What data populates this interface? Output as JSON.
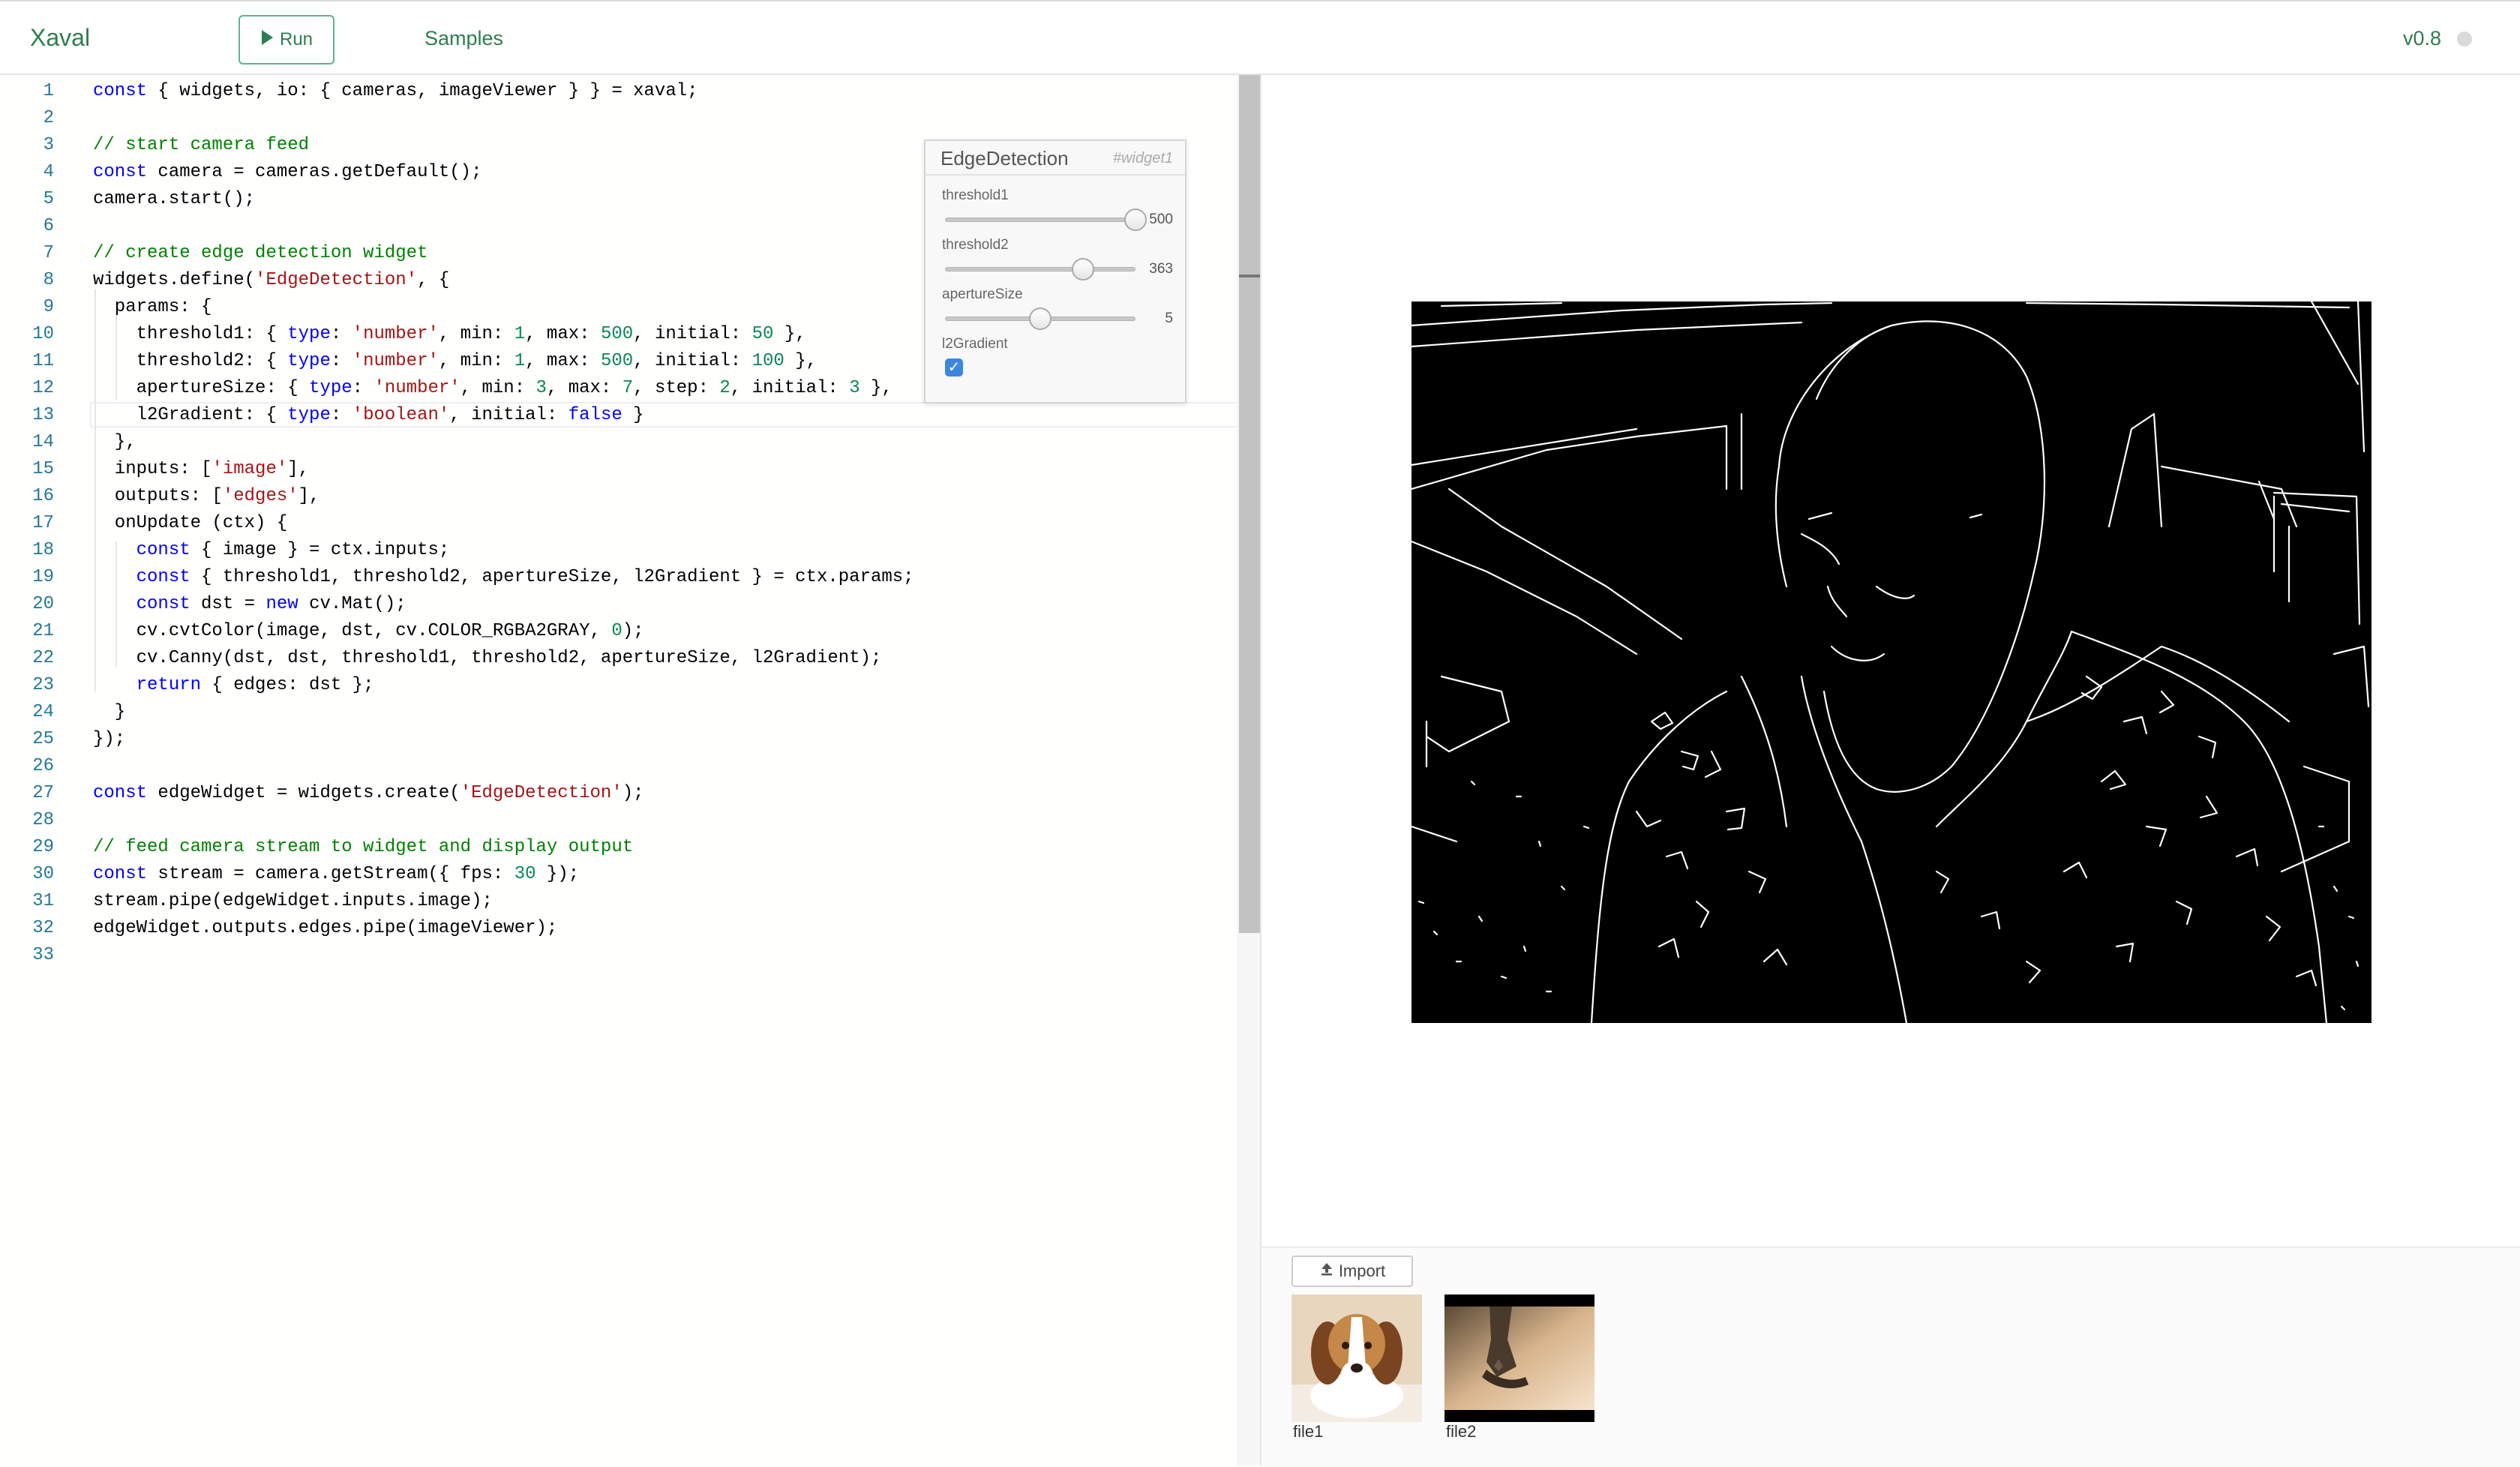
{
  "header": {
    "brand": "Xaval",
    "run_label": "Run",
    "samples_label": "Samples",
    "version": "v0.8"
  },
  "editor": {
    "lines": [
      {
        "n": "1",
        "html": "<span class=\"kw\">const</span> { widgets, io: { cameras, imageViewer } } = xaval;"
      },
      {
        "n": "2",
        "html": ""
      },
      {
        "n": "3",
        "html": "<span class=\"cmt\">// start camera feed</span>"
      },
      {
        "n": "4",
        "html": "<span class=\"kw\">const</span> camera = cameras.getDefault();"
      },
      {
        "n": "5",
        "html": "camera.start();"
      },
      {
        "n": "6",
        "html": ""
      },
      {
        "n": "7",
        "html": "<span class=\"cmt\">// create edge detection widget</span>"
      },
      {
        "n": "8",
        "html": "widgets.define(<span class=\"str\">'EdgeDetection'</span>, {"
      },
      {
        "n": "9",
        "html": "  params: {"
      },
      {
        "n": "10",
        "html": "    threshold1: { <span class=\"kw\">type</span>: <span class=\"str\">'number'</span>, min: <span class=\"num\">1</span>, max: <span class=\"num\">500</span>, initial: <span class=\"num\">50</span> },"
      },
      {
        "n": "11",
        "html": "    threshold2: { <span class=\"kw\">type</span>: <span class=\"str\">'number'</span>, min: <span class=\"num\">1</span>, max: <span class=\"num\">500</span>, initial: <span class=\"num\">100</span> },"
      },
      {
        "n": "12",
        "html": "    apertureSize: { <span class=\"kw\">type</span>: <span class=\"str\">'number'</span>, min: <span class=\"num\">3</span>, max: <span class=\"num\">7</span>, step: <span class=\"num\">2</span>, initial: <span class=\"num\">3</span> },"
      },
      {
        "n": "13",
        "html": "    l2Gradient: { <span class=\"kw\">type</span>: <span class=\"str\">'boolean'</span>, initial: <span class=\"kw\">false</span> }"
      },
      {
        "n": "14",
        "html": "  },"
      },
      {
        "n": "15",
        "html": "  inputs: [<span class=\"str\">'image'</span>],"
      },
      {
        "n": "16",
        "html": "  outputs: [<span class=\"str\">'edges'</span>],"
      },
      {
        "n": "17",
        "html": "  onUpdate (ctx) {"
      },
      {
        "n": "18",
        "html": "    <span class=\"kw\">const</span> { image } = ctx.inputs;"
      },
      {
        "n": "19",
        "html": "    <span class=\"kw\">const</span> { threshold1, threshold2, apertureSize, l2Gradient } = ctx.params;"
      },
      {
        "n": "20",
        "html": "    <span class=\"kw\">const</span> dst = <span class=\"kw\">new</span> cv.Mat();"
      },
      {
        "n": "21",
        "html": "    cv.cvtColor(image, dst, cv.COLOR_RGBA2GRAY, <span class=\"num\">0</span>);"
      },
      {
        "n": "22",
        "html": "    cv.Canny(dst, dst, threshold1, threshold2, apertureSize, l2Gradient);"
      },
      {
        "n": "23",
        "html": "    <span class=\"kw\">return</span> { edges: dst };"
      },
      {
        "n": "24",
        "html": "  }"
      },
      {
        "n": "25",
        "html": "});"
      },
      {
        "n": "26",
        "html": ""
      },
      {
        "n": "27",
        "html": "<span class=\"kw\">const</span> edgeWidget = widgets.create(<span class=\"str\">'EdgeDetection'</span>);"
      },
      {
        "n": "28",
        "html": ""
      },
      {
        "n": "29",
        "html": "<span class=\"cmt\">// feed camera stream to widget and display output</span>"
      },
      {
        "n": "30",
        "html": "<span class=\"kw\">const</span> stream = camera.getStream({ fps: <span class=\"num\">30</span> });"
      },
      {
        "n": "31",
        "html": "stream.pipe(edgeWidget.inputs.image);"
      },
      {
        "n": "32",
        "html": "edgeWidget.outputs.edges.pipe(imageViewer);"
      },
      {
        "n": "33",
        "html": ""
      }
    ]
  },
  "widget": {
    "title": "EdgeDetection",
    "id": "#widget1",
    "params": [
      {
        "label": "threshold1",
        "value": "500",
        "fraction": 1.0
      },
      {
        "label": "threshold2",
        "value": "363",
        "fraction": 0.725
      },
      {
        "label": "apertureSize",
        "value": "5",
        "fraction": 0.5
      }
    ],
    "bool_param": {
      "label": "l2Gradient",
      "checked": true
    }
  },
  "files": {
    "import_label": "Import",
    "items": [
      {
        "name": "file1",
        "icon": "beagle-puppy-thumbnail"
      },
      {
        "name": "file2",
        "icon": "hand-sunset-thumbnail"
      }
    ]
  },
  "colors": {
    "brand": "#2e7d4f",
    "keyword": "#0000ff",
    "string": "#a31515",
    "number": "#098658",
    "comment": "#008000",
    "line_number": "#237893",
    "checkbox": "#3b86e0"
  }
}
